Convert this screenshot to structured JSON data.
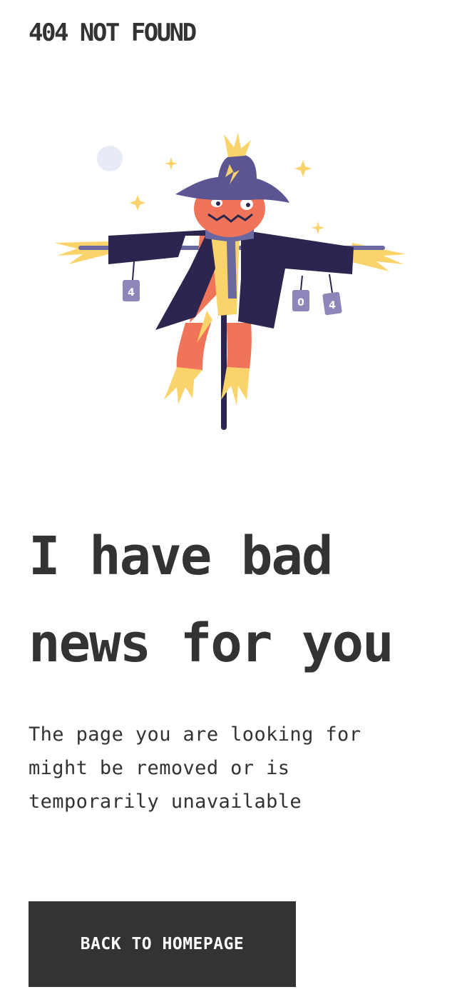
{
  "header": {
    "logo_text": "404 NOT FOUND"
  },
  "illustration": {
    "name": "scarecrow",
    "can_labels": [
      "4",
      "0",
      "4"
    ],
    "colors": {
      "hat": "#5b5591",
      "face": "#ef7459",
      "coat": "#2b254f",
      "straw": "#fbd36b",
      "scarf": "#6a68a0",
      "cans": "#8c87b8",
      "moon": "#e6ebf5"
    }
  },
  "main": {
    "headline": "I have bad news for you",
    "description": "The page you are looking for might be removed or is temporarily unavailable",
    "cta_label": "BACK TO HOMEPAGE"
  },
  "colors": {
    "text": "#333333",
    "button_bg": "#333333",
    "button_text": "#ffffff",
    "background": "#ffffff"
  }
}
